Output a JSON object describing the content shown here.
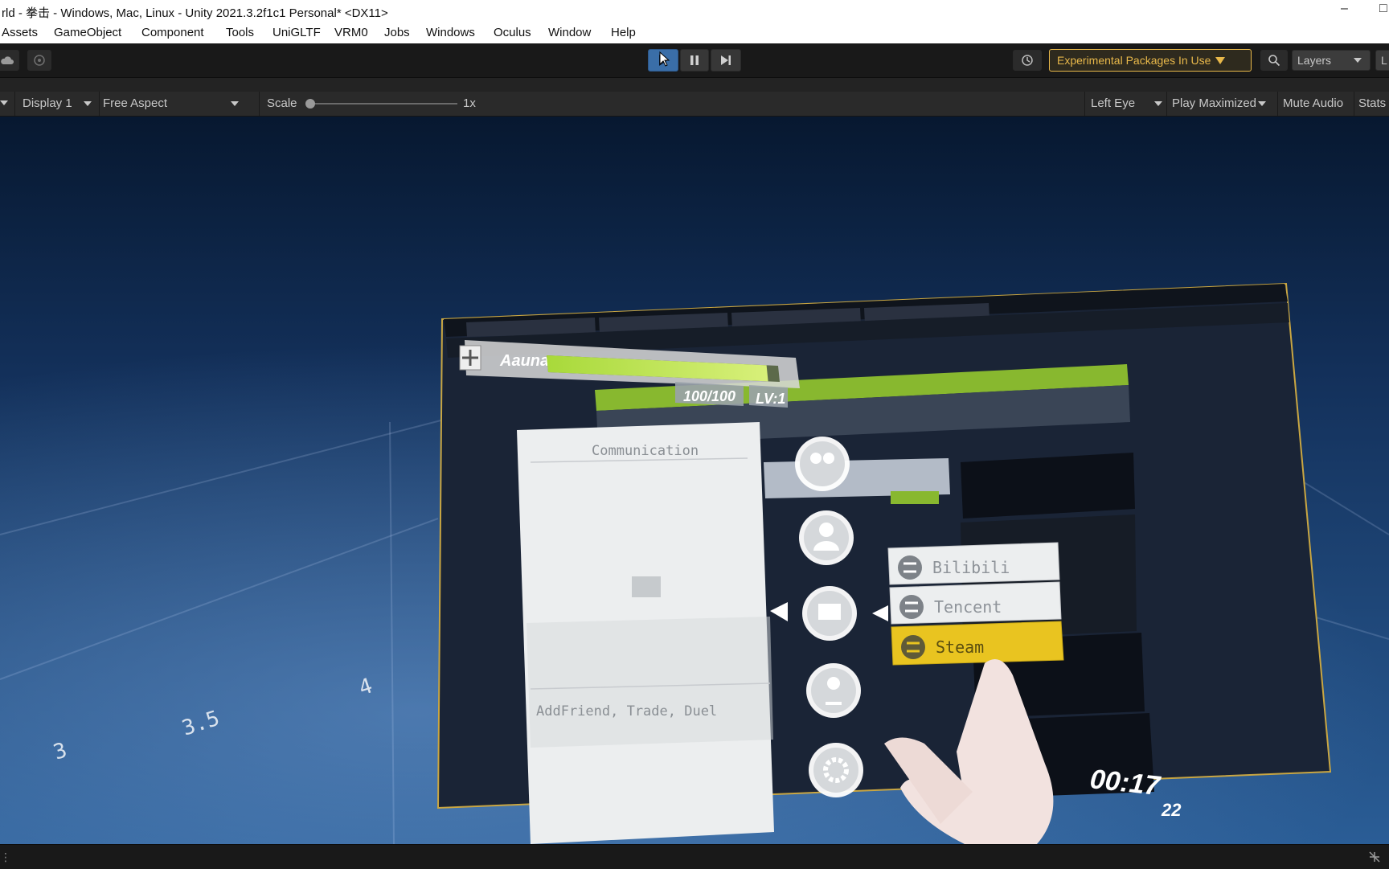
{
  "window": {
    "title": "rld - 拳击 - Windows, Mac, Linux - Unity 2021.3.2f1c1 Personal* <DX11>",
    "minimize_glyph": "–",
    "restore_glyph": "□"
  },
  "menu": [
    "Assets",
    "GameObject",
    "Component",
    "Tools",
    "UniGLTF",
    "VRM0",
    "Jobs",
    "Windows",
    "Oculus",
    "Window",
    "Help"
  ],
  "toolbar": {
    "cloud_icon": "cloud-icon",
    "collab_icon": "collab-icon",
    "play_icon": "play-icon",
    "pause_icon": "pause-icon",
    "step_icon": "step-icon",
    "history_icon": "history-icon",
    "experimental_label": "Experimental Packages In Use",
    "search_icon": "search-icon",
    "layers_label": "Layers",
    "layout_label": "L",
    "play_active": true
  },
  "game_toolbar": {
    "display": "Display 1",
    "aspect": "Free Aspect",
    "scale_label": "Scale",
    "scale_value": "1x",
    "eye": "Left Eye",
    "play_mode": "Play Maximized",
    "mute": "Mute Audio",
    "stats": "Stats"
  },
  "scene": {
    "grid_numbers": [
      "3",
      "3.5",
      "4"
    ],
    "player_name": "Aauna",
    "hp": "100/100",
    "level": "LV:1",
    "hp_fraction": 0.95,
    "panel_title": "Communication",
    "panel_footer": "AddFriend, Trade, Duel",
    "options": [
      {
        "label": "Bilibili",
        "selected": false
      },
      {
        "label": "Tencent",
        "selected": false
      },
      {
        "label": "Steam",
        "selected": true
      }
    ],
    "menu_icons": [
      "friends-icon",
      "user-icon",
      "chat-icon",
      "location-icon",
      "settings-icon"
    ],
    "clock": "00:17",
    "date": "22"
  },
  "colors": {
    "accent_blue": "#2f5d9a",
    "experimental_gold": "#e8b84a",
    "hp_green": "#b8e04a",
    "steam_yellow": "#e9c420"
  }
}
